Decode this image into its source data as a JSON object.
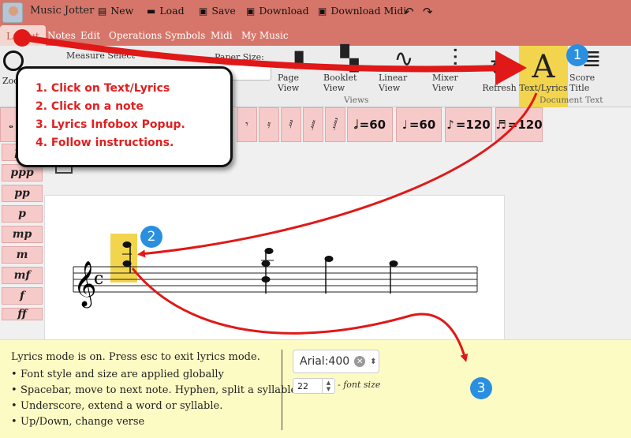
{
  "topbar": {
    "app_title": "Music Jotter",
    "new_label": "New",
    "load_label": "Load",
    "save_label": "Save",
    "download_label": "Download",
    "download_midi_label": "Download Midi",
    "undo_icon": "undo-icon",
    "redo_icon": "redo-icon"
  },
  "menu": {
    "items": [
      "Layout",
      "Notes",
      "Edit",
      "Operations",
      "Symbols",
      "Midi",
      "My Music"
    ],
    "active": "Layout"
  },
  "ribbon": {
    "zoom_label": "Zoo",
    "measure_select": "Measure Select",
    "paper_size": "Paper Size:",
    "views": [
      "Page View",
      "Booklet View",
      "Linear View",
      "Mixer View",
      "Refresh"
    ],
    "views_group": "Views",
    "text_lyrics": "Text/Lyrics",
    "score_title": "Score Title",
    "document_text_group": "Document Text"
  },
  "palette": {
    "tempos": [
      {
        "note": "half-note",
        "value": "=60"
      },
      {
        "note": "quarter-note",
        "value": "=60"
      },
      {
        "note": "eighth-note",
        "value": "=120"
      },
      {
        "note": "sixteenth-note",
        "value": "=120"
      }
    ]
  },
  "dynamics": [
    "pp",
    "ppp",
    "pp",
    "p",
    "mp",
    "m",
    "mf",
    "f",
    "ff"
  ],
  "callout": {
    "steps": [
      "1. Click on Text/Lyrics",
      "2. Click on a note",
      "3. Lyrics Infobox Popup.",
      "4. Follow instructions."
    ]
  },
  "infobox": {
    "title": "Lyrics mode is on. Press esc to exit lyrics mode.",
    "bullets": [
      "Font style and size are applied globally",
      "Spacebar, move to next note. Hyphen, split a syllable.",
      "Underscore, extend a word or syllable.",
      "Up/Down, change verse"
    ],
    "font_value": "Arial:400",
    "font_size_value": "22",
    "font_size_label": "- font size"
  },
  "badges": [
    "1",
    "2",
    "3"
  ],
  "colors": {
    "topbar": "#d6766a",
    "highlight": "#f2d54d",
    "arrow": "#e01818",
    "badge": "#2a8fe0",
    "infobox": "#fdfbc4",
    "palette_button": "#f7caca"
  }
}
